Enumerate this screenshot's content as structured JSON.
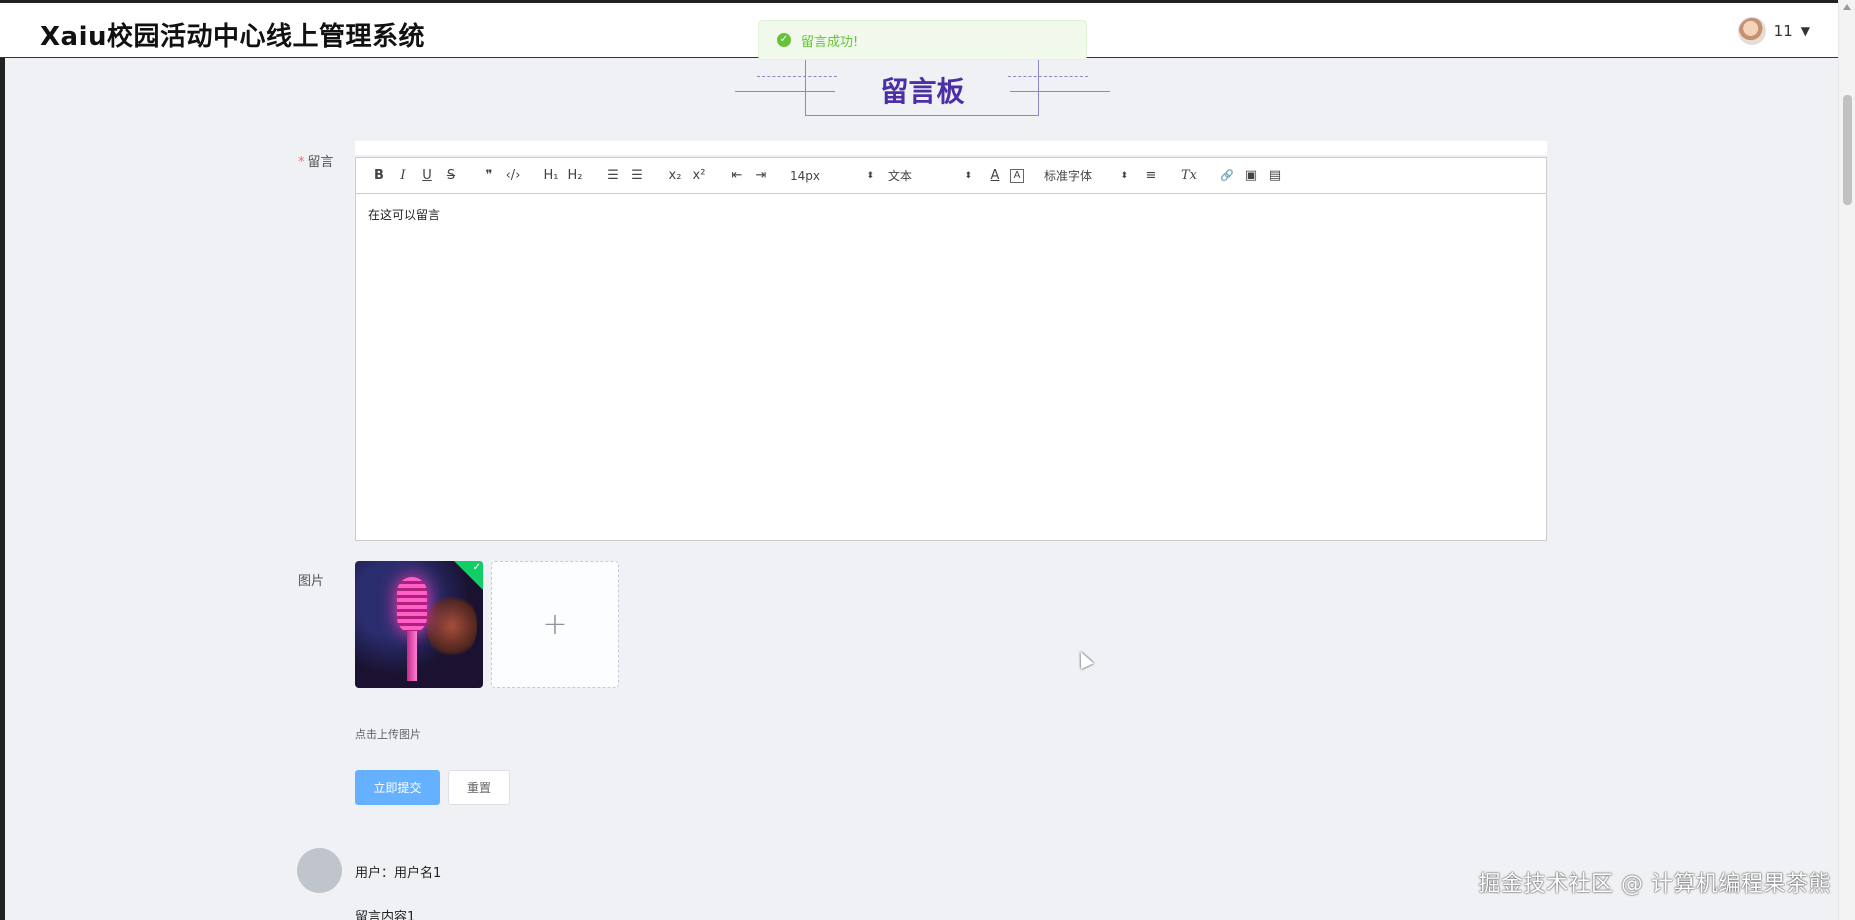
{
  "header": {
    "app_title": "Xaiu校园活动中心线上管理系统",
    "username": "11",
    "caret": "▼"
  },
  "toast": {
    "message": "留言成功!",
    "icon": "check-circle-icon",
    "color": "#67c23a"
  },
  "board": {
    "title": "留言板",
    "title_color": "#4b2fa6"
  },
  "form": {
    "message_label": "留言",
    "required_mark": "*",
    "image_label": "图片",
    "upload_tip": "点击上传图片",
    "upload_plus": "+",
    "submit_label": "立即提交",
    "reset_label": "重置"
  },
  "editor": {
    "toolbar": {
      "bold": "B",
      "italic": "I",
      "underline": "U",
      "strike": "S",
      "blockquote": "❞",
      "code": "‹/›",
      "h1": "H₁",
      "h2": "H₂",
      "ordered_list": "☰",
      "bullet_list": "☰",
      "subscript": "x₂",
      "superscript": "x²",
      "outdent": "⇤",
      "indent": "⇥",
      "size_value": "14px",
      "header_value": "文本",
      "font_value": "标准字体",
      "color": "A",
      "background": "A",
      "align": "≡",
      "clean": "Tx",
      "link": "🔗",
      "image": "▣",
      "video": "▤",
      "select_arrow": "⬍"
    },
    "content": "在这可以留言"
  },
  "comments": [
    {
      "user_label": "用户：用户名1",
      "content_label": "留言内容1"
    }
  ],
  "watermark": "掘金技术社区 @ 计算机编程果茶熊"
}
